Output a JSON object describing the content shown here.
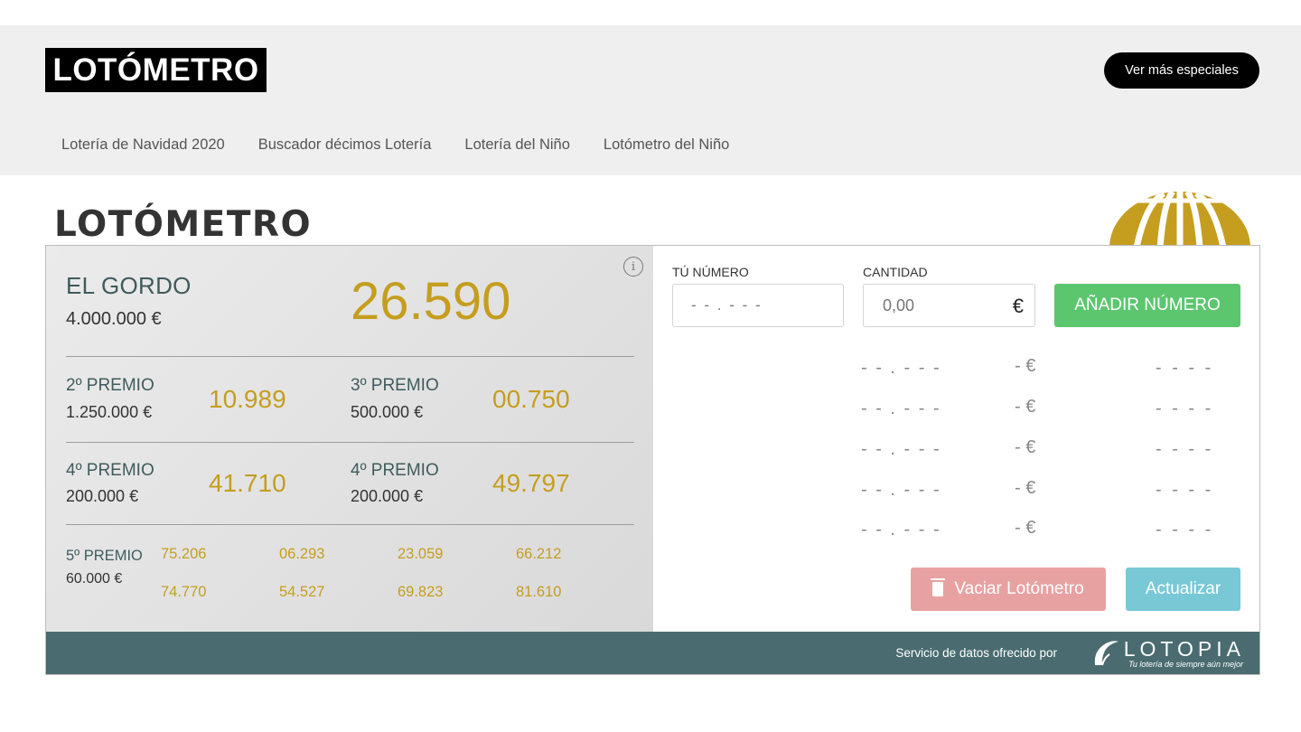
{
  "header": {
    "logo": "LOTÓMETRO",
    "more_button": "Ver más especiales",
    "nav": [
      {
        "label": "Lotería de Navidad 2020"
      },
      {
        "label": "Buscador décimos Lotería"
      },
      {
        "label": "Lotería del Niño"
      },
      {
        "label": "Lotómetro del Niño"
      }
    ]
  },
  "widget": {
    "title": "LOTÓMETRO",
    "results": {
      "gordo": {
        "name": "EL GORDO",
        "amount": "4.000.000 €",
        "number": "26.590"
      },
      "second": {
        "name": "2º PREMIO",
        "amount": "1.250.000 €",
        "number": "10.989"
      },
      "third": {
        "name": "3º PREMIO",
        "amount": "500.000 €",
        "number": "00.750"
      },
      "fourth_a": {
        "name": "4º PREMIO",
        "amount": "200.000 €",
        "number": "41.710"
      },
      "fourth_b": {
        "name": "4º PREMIO",
        "amount": "200.000 €",
        "number": "49.797"
      },
      "fifth": {
        "name": "5º PREMIO",
        "amount": "60.000 €",
        "numbers": [
          "75.206",
          "06.293",
          "23.059",
          "66.212",
          "74.770",
          "54.527",
          "69.823",
          "81.610"
        ]
      }
    },
    "form": {
      "number_label": "TÚ NÚMERO",
      "number_placeholder": "- - . - - -",
      "quantity_label": "CANTIDAD",
      "quantity_placeholder": "0,00",
      "currency": "€",
      "add_button": "AÑADIR NÚMERO"
    },
    "slots": [
      {
        "number": "- - . - - -",
        "amount": "- €",
        "prize": "- - - -"
      },
      {
        "number": "- - . - - -",
        "amount": "- €",
        "prize": "- - - -"
      },
      {
        "number": "- - . - - -",
        "amount": "- €",
        "prize": "- - - -"
      },
      {
        "number": "- - . - - -",
        "amount": "- €",
        "prize": "- - - -"
      },
      {
        "number": "- - . - - -",
        "amount": "- €",
        "prize": "- - - -"
      }
    ],
    "clear_button": "Vaciar Lotómetro",
    "update_button": "Actualizar",
    "footer": {
      "text": "Servicio de datos ofrecido por",
      "brand": "LOTOPIA",
      "tagline": "Tu lotería de siempre aún mejor"
    }
  },
  "colors": {
    "gold": "#c59e1f",
    "teal_footer": "#4a6c70",
    "green_button": "#5cc66f",
    "red_button": "#e8a1a1",
    "blue_button": "#78c8d6"
  }
}
